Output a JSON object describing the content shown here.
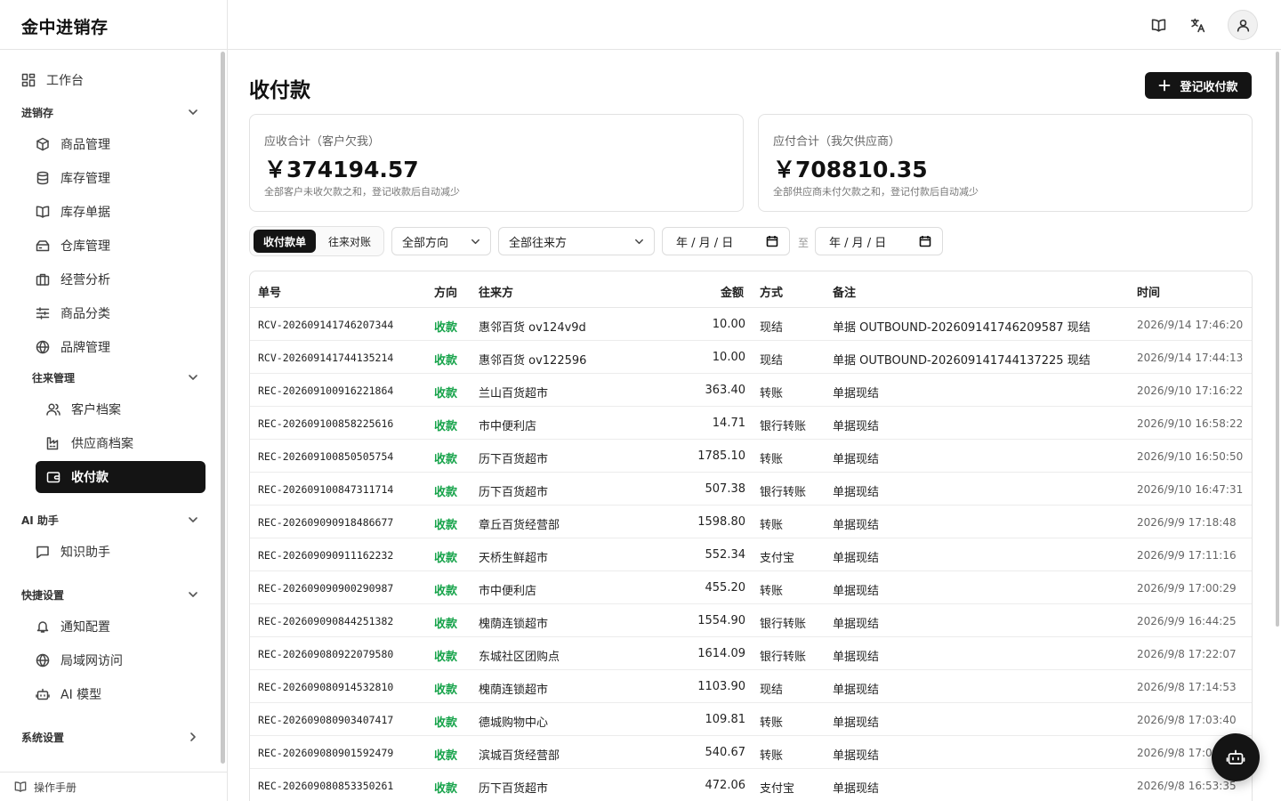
{
  "app": {
    "brand": "金中进销存"
  },
  "sidebar": {
    "workbench": "工作台",
    "groups": {
      "inventory": "进销存",
      "contacts": "往来管理",
      "ai": "AI 助手",
      "shortcuts": "快捷设置",
      "system": "系统设置"
    },
    "items": {
      "products": "商品管理",
      "stock": "库存管理",
      "stock_docs": "库存单据",
      "warehouse": "仓库管理",
      "analytics": "经营分析",
      "categories": "商品分类",
      "brands": "品牌管理",
      "customers": "客户档案",
      "suppliers": "供应商档案",
      "payments": "收付款",
      "knowledge": "知识助手",
      "notify": "通知配置",
      "lan": "局域网访问",
      "ai_model": "AI 模型"
    },
    "footer": "操作手册"
  },
  "header": {
    "icons": [
      "book-icon",
      "translate-icon",
      "user-icon"
    ]
  },
  "page": {
    "title": "收付款",
    "add_button": "登记收付款"
  },
  "cards": {
    "receivable": {
      "label": "应收合计（客户欠我）",
      "value": "￥374194.57",
      "hint": "全部客户未收欠款之和，登记收款后自动减少"
    },
    "payable": {
      "label": "应付合计（我欠供应商）",
      "value": "￥708810.35",
      "hint": "全部供应商未付欠款之和，登记付款后自动减少"
    }
  },
  "filters": {
    "tabs": [
      "收付款单",
      "往来对账"
    ],
    "direction": "全部方向",
    "party": "全部往来方",
    "date_from": "年 / 月 / 日",
    "date_to": "年 / 月 / 日",
    "to": "至"
  },
  "table": {
    "columns": [
      "单号",
      "方向",
      "往来方",
      "金额",
      "方式",
      "备注",
      "时间"
    ],
    "rows": [
      {
        "no": "RCV-202609141746207344",
        "dir": "收款",
        "party": "惠邻百货 ov124v9d",
        "amount": "10.00",
        "method": "现结",
        "note": "单据 OUTBOUND-202609141746209587 现结",
        "time": "2026/9/14 17:46:20"
      },
      {
        "no": "RCV-202609141744135214",
        "dir": "收款",
        "party": "惠邻百货 ov122596",
        "amount": "10.00",
        "method": "现结",
        "note": "单据 OUTBOUND-202609141744137225 现结",
        "time": "2026/9/14 17:44:13"
      },
      {
        "no": "REC-202609100916221864",
        "dir": "收款",
        "party": "兰山百货超市",
        "amount": "363.40",
        "method": "转账",
        "note": "单据现结",
        "time": "2026/9/10 17:16:22"
      },
      {
        "no": "REC-202609100858225616",
        "dir": "收款",
        "party": "市中便利店",
        "amount": "14.71",
        "method": "银行转账",
        "note": "单据现结",
        "time": "2026/9/10 16:58:22"
      },
      {
        "no": "REC-202609100850505754",
        "dir": "收款",
        "party": "历下百货超市",
        "amount": "1785.10",
        "method": "转账",
        "note": "单据现结",
        "time": "2026/9/10 16:50:50"
      },
      {
        "no": "REC-202609100847311714",
        "dir": "收款",
        "party": "历下百货超市",
        "amount": "507.38",
        "method": "银行转账",
        "note": "单据现结",
        "time": "2026/9/10 16:47:31"
      },
      {
        "no": "REC-202609090918486677",
        "dir": "收款",
        "party": "章丘百货经营部",
        "amount": "1598.80",
        "method": "转账",
        "note": "单据现结",
        "time": "2026/9/9 17:18:48"
      },
      {
        "no": "REC-202609090911162232",
        "dir": "收款",
        "party": "天桥生鲜超市",
        "amount": "552.34",
        "method": "支付宝",
        "note": "单据现结",
        "time": "2026/9/9 17:11:16"
      },
      {
        "no": "REC-202609090900290987",
        "dir": "收款",
        "party": "市中便利店",
        "amount": "455.20",
        "method": "转账",
        "note": "单据现结",
        "time": "2026/9/9 17:00:29"
      },
      {
        "no": "REC-202609090844251382",
        "dir": "收款",
        "party": "槐荫连锁超市",
        "amount": "1554.90",
        "method": "银行转账",
        "note": "单据现结",
        "time": "2026/9/9 16:44:25"
      },
      {
        "no": "REC-202609080922079580",
        "dir": "收款",
        "party": "东城社区团购点",
        "amount": "1614.09",
        "method": "银行转账",
        "note": "单据现结",
        "time": "2026/9/8 17:22:07"
      },
      {
        "no": "REC-202609080914532810",
        "dir": "收款",
        "party": "槐荫连锁超市",
        "amount": "1103.90",
        "method": "现结",
        "note": "单据现结",
        "time": "2026/9/8 17:14:53"
      },
      {
        "no": "REC-202609080903407417",
        "dir": "收款",
        "party": "德城购物中心",
        "amount": "109.81",
        "method": "转账",
        "note": "单据现结",
        "time": "2026/9/8 17:03:40"
      },
      {
        "no": "REC-202609080901592479",
        "dir": "收款",
        "party": "滨城百货经营部",
        "amount": "540.67",
        "method": "转账",
        "note": "单据现结",
        "time": "2026/9/8 17:01:59"
      },
      {
        "no": "REC-202609080853350261",
        "dir": "收款",
        "party": "历下百货超市",
        "amount": "472.06",
        "method": "支付宝",
        "note": "单据现结",
        "time": "2026/9/8 16:53:35"
      }
    ]
  },
  "colors": {
    "accent": "#141414",
    "income": "#16a34a",
    "border": "#e2e2e2"
  }
}
